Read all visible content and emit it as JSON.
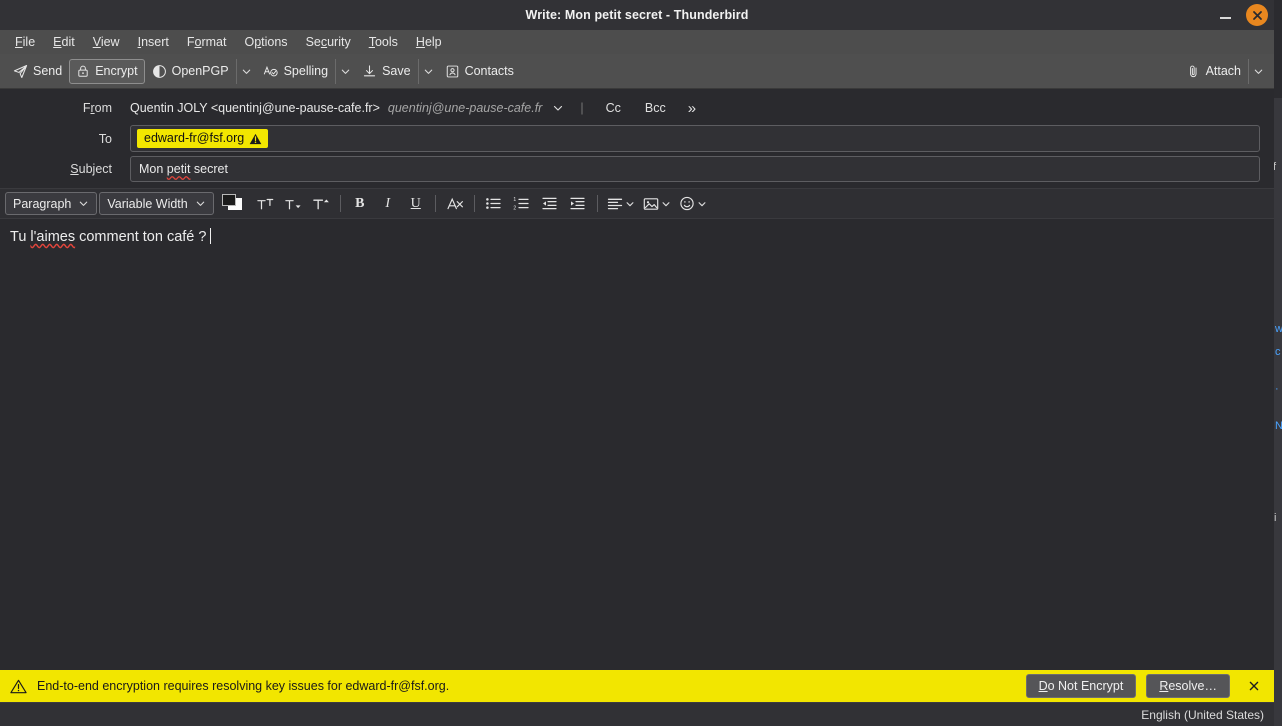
{
  "window": {
    "title": "Write: Mon petit secret - Thunderbird",
    "minimize_label": "Minimize",
    "close_label": "Close"
  },
  "menubar": {
    "items": [
      {
        "label": "File",
        "accel": "F"
      },
      {
        "label": "Edit",
        "accel": "E"
      },
      {
        "label": "View",
        "accel": "V"
      },
      {
        "label": "Insert",
        "accel": "I"
      },
      {
        "label": "Format",
        "accel": "o"
      },
      {
        "label": "Options",
        "accel": "p"
      },
      {
        "label": "Security",
        "accel": "c"
      },
      {
        "label": "Tools",
        "accel": "T"
      },
      {
        "label": "Help",
        "accel": "H"
      }
    ]
  },
  "toolbar": {
    "send_label": "Send",
    "encrypt_label": "Encrypt",
    "encrypt_active": true,
    "openpgp_label": "OpenPGP",
    "spelling_label": "Spelling",
    "save_label": "Save",
    "contacts_label": "Contacts",
    "attach_label": "Attach"
  },
  "headers": {
    "from": {
      "label": "From",
      "accel": "r",
      "identity": "Quentin JOLY <quentinj@une-pause-cafe.fr>",
      "email": "quentinj@une-pause-cafe.fr",
      "cc_label": "Cc",
      "bcc_label": "Bcc",
      "more_label": "»"
    },
    "to": {
      "label": "To",
      "recipient": "edward-fr@fsf.org",
      "has_warning": true,
      "pill_color": "#f2e600"
    },
    "subject": {
      "label": "Subject",
      "accel": "S",
      "value": "Mon petit secret",
      "misspelled_word": "petit",
      "value_before": "Mon ",
      "value_after": " secret",
      "placeholder": "Subject"
    }
  },
  "formatbar": {
    "paragraph_label": "Paragraph",
    "font_label": "Variable Width",
    "buttons": [
      "text-color-swatch",
      "increase-font-size",
      "decrease-font-size",
      "font-size-menu",
      "bold",
      "italic",
      "underline",
      "remove-text-styling",
      "bullet-list",
      "numbered-list",
      "outdent",
      "indent",
      "align-menu",
      "insert-image-menu",
      "emoji-menu"
    ]
  },
  "body": {
    "text_before": "Tu ",
    "misspelled_word": "l'aimes",
    "text_after": " comment ton café ?",
    "full_text": "Tu l'aimes comment ton café ?"
  },
  "notification": {
    "message": "End-to-end encryption requires resolving key issues for edward-fr@fsf.org.",
    "background": "#f2e600",
    "do_not_encrypt_label": "Do Not Encrypt",
    "do_not_encrypt_accel": "D",
    "resolve_label": "Resolve…",
    "resolve_accel": "R",
    "close_label": "×"
  },
  "statusbar": {
    "language": "English (United States)"
  },
  "background_window": {
    "fragments": [
      "f",
      "w",
      "c",
      "·",
      "N",
      "i"
    ]
  }
}
